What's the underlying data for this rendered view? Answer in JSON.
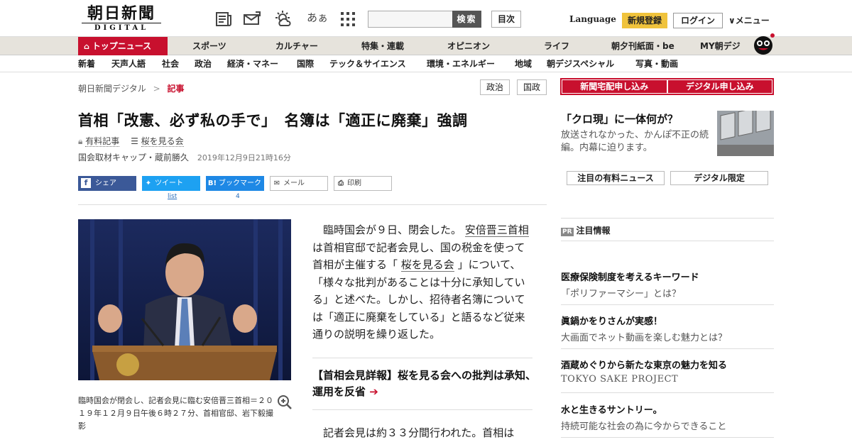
{
  "header": {
    "logo_main": "朝日新聞",
    "logo_sub": "DIGITAL",
    "search_placeholder": "",
    "search_button": "検索",
    "toc_button": "目次",
    "language": "Language",
    "signup": "新規登録",
    "login": "ログイン",
    "menu": "∨メニュー",
    "kana_icon": "あぁ"
  },
  "nav1": {
    "top_news": "トップニュース",
    "items": [
      "スポーツ",
      "カルチャー",
      "特集・連載",
      "オピニオン",
      "ライフ",
      "朝夕刊紙面・be",
      "MY朝デジ"
    ]
  },
  "nav2": {
    "items": [
      "新着",
      "天声人語",
      "社会",
      "政治",
      "経済・マネー",
      "国際",
      "テック＆サイエンス",
      "環境・エネルギー",
      "地域",
      "朝デジスペシャル",
      "写真・動画"
    ]
  },
  "breadcrumb": {
    "home": "朝日新聞デジタル",
    "sep": ">",
    "current": "記事",
    "tags": [
      "政治",
      "国政"
    ]
  },
  "article": {
    "headline": "首相「改憲、必ず私の手で」　名簿は「適正に廃棄」強調",
    "paid_label": "有料記事",
    "series_label": "桜を見る会",
    "author": "国会取材キャップ・蔵前勝久",
    "date": "2019年12月9日21時16分",
    "share": {
      "facebook": "シェア",
      "twitter": "ツイート",
      "twitter_count": "list",
      "hatena": "ブックマーク",
      "hatena_count": "4",
      "mail": "メール",
      "print": "印刷"
    },
    "caption": "臨時国会が閉会し、記者会見に臨む安倍晋三首相＝２０１９年１２月９日午後６時２７分、首相官邸、岩下毅撮影",
    "body_1a": "臨時国会が９日、閉会した。",
    "body_link1": "安倍晋三首相",
    "body_1b": "は首相官邸で記者会見し、国の税金を使って首相が主催する「",
    "body_link2": "桜を見る会",
    "body_1c": "」について、「様々な批判があることは十分に承知している」と述べた。しかし、招待者名簿については「適正に廃棄をしている」と語るなど従来通りの説明を繰り返した。",
    "related": "【首相会見詳報】桜を見る会への批判は承知、運用を反省",
    "body_2": "記者会見は約３３分間行われた。首相は"
  },
  "right": {
    "btn_paper": "新聞宅配申し込み",
    "btn_digital": "デジタル申し込み",
    "promo_title": "「クロ現」に一体何が？",
    "promo_text": "放送されなかった、かんぽ不正の続編。内幕に迫ります。",
    "btn_paid_news": "注目の有料ニュース",
    "btn_digital_only": "デジタル限定",
    "pr_badge": "PR",
    "pr_title": "注目情報",
    "items": [
      {
        "title": "医療保険制度を考えるキーワード",
        "sub": "「ポリファーマシー」とは？"
      },
      {
        "title": "眞鍋かをりさんが実感！",
        "sub": "大画面でネット動画を楽しむ魅力とは？"
      },
      {
        "title": "酒蔵めぐりから新たな東京の魅力を知る",
        "sub": "TOKYO SAKE PROJECT"
      },
      {
        "title": "水と生きるサントリー。",
        "sub": "持続可能な社会の為に今からできること"
      }
    ]
  },
  "colors": {
    "brand_red": "#c8102e",
    "signup_yellow": "#f0c33c",
    "facebook": "#3b5998",
    "twitter": "#1da1f2",
    "hatena": "#1e88e5"
  }
}
